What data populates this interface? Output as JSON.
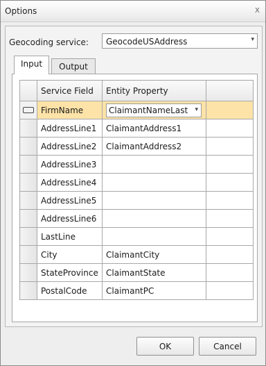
{
  "window": {
    "title": "Options",
    "close_glyph": "x"
  },
  "geocoding": {
    "label": "Geocoding service:",
    "value": "GeocodeUSAddress",
    "arrow_glyph": "▾"
  },
  "tabs": [
    {
      "label": "Input",
      "selected": true
    },
    {
      "label": "Output",
      "selected": false
    }
  ],
  "grid": {
    "headers": [
      "Service Field",
      "Entity Property"
    ],
    "rows": [
      {
        "service_field": "FirmName",
        "entity_property": "ClaimantNameLast",
        "current": true
      },
      {
        "service_field": "AddressLine1",
        "entity_property": "ClaimantAddress1"
      },
      {
        "service_field": "AddressLine2",
        "entity_property": "ClaimantAddress2"
      },
      {
        "service_field": "AddressLine3",
        "entity_property": ""
      },
      {
        "service_field": "AddressLine4",
        "entity_property": ""
      },
      {
        "service_field": "AddressLine5",
        "entity_property": ""
      },
      {
        "service_field": "AddressLine6",
        "entity_property": ""
      },
      {
        "service_field": "LastLine",
        "entity_property": ""
      },
      {
        "service_field": "City",
        "entity_property": "ClaimantCity"
      },
      {
        "service_field": "StateProvince",
        "entity_property": "ClaimantState"
      },
      {
        "service_field": "PostalCode",
        "entity_property": "ClaimantPC"
      }
    ],
    "current_row_color": "#fde3a7"
  },
  "buttons": {
    "ok": "OK",
    "cancel": "Cancel"
  }
}
